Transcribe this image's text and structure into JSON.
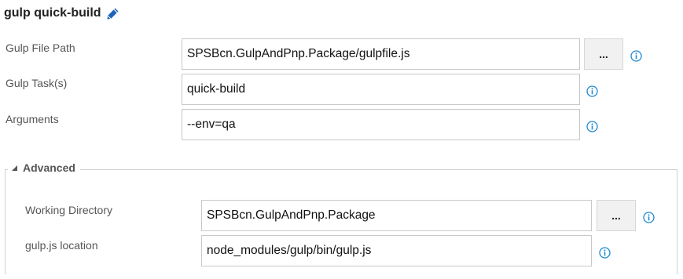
{
  "task": {
    "title": "gulp quick-build",
    "edit_icon": "pencil-icon"
  },
  "fields": [
    {
      "label": "Gulp File Path",
      "value": "SPSBcn.GulpAndPnp.Package/gulpfile.js"
    },
    {
      "label": "Gulp Task(s)",
      "value": "quick-build"
    },
    {
      "label": "Arguments",
      "value": "--env=qa"
    }
  ],
  "browse_label": "...",
  "advanced": {
    "label": "Advanced",
    "expanded": true,
    "fields": [
      {
        "label": "Working Directory",
        "value": "SPSBcn.GulpAndPnp.Package"
      },
      {
        "label": "gulp.js location",
        "value": "node_modules/gulp/bin/gulp.js"
      }
    ]
  },
  "colors": {
    "accent": "#0078d7",
    "icon_blue": "#1e88d2",
    "label_gray": "#555555",
    "border": "#c8c8c8"
  }
}
